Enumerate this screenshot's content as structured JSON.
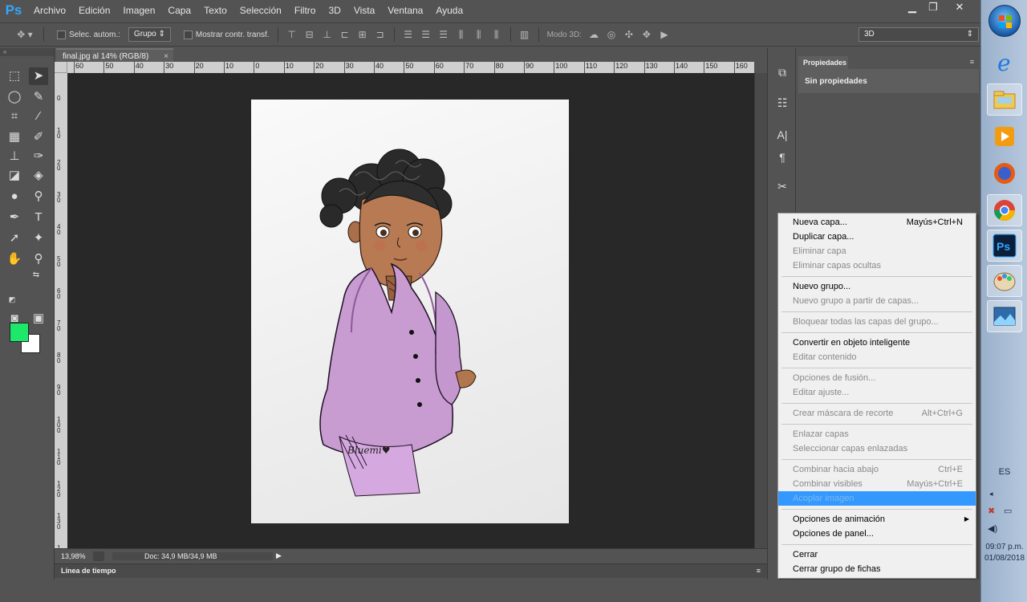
{
  "app": {
    "logo": "Ps",
    "menus": [
      "Archivo",
      "Edición",
      "Imagen",
      "Capa",
      "Texto",
      "Selección",
      "Filtro",
      "3D",
      "Vista",
      "Ventana",
      "Ayuda"
    ]
  },
  "options_bar": {
    "auto_select_label": "Selec. autom.:",
    "auto_select_value": "Grupo",
    "show_transform_label": "Mostrar contr. transf.",
    "mode_3d_label": "Modo 3D:",
    "workspace_value": "3D"
  },
  "document": {
    "tab_title": "final.jpg al 14% (RGB/8)",
    "tab_close": "×",
    "artwork_signature": "Bluemi♥"
  },
  "rulers": {
    "horizontal": [
      "60",
      "50",
      "40",
      "30",
      "20",
      "10",
      "0",
      "10",
      "20",
      "30",
      "40",
      "50",
      "60",
      "70",
      "80",
      "90",
      "100",
      "110",
      "120",
      "130",
      "140",
      "150",
      "160"
    ],
    "vertical": [
      "0",
      "1 0",
      "2 0",
      "3 0",
      "4 0",
      "5 0",
      "6 0",
      "7 0",
      "8 0",
      "9 0",
      "1 0 0",
      "1 1 0",
      "1 2 0",
      "1 3 0",
      "1 4 0"
    ]
  },
  "status": {
    "zoom": "13,98%",
    "doc_size": "Doc: 34,9 MB/34,9 MB"
  },
  "timeline": {
    "label": "Línea de tiempo"
  },
  "properties": {
    "tab_label": "Propiedades",
    "body_text": "Sin propiedades"
  },
  "context_menu": {
    "items": [
      {
        "label": "Nueva capa...",
        "shortcut": "Mayús+Ctrl+N",
        "disabled": false
      },
      {
        "label": "Duplicar capa...",
        "shortcut": "",
        "disabled": false
      },
      {
        "label": "Eliminar capa",
        "shortcut": "",
        "disabled": true
      },
      {
        "label": "Eliminar capas ocultas",
        "shortcut": "",
        "disabled": true
      },
      {
        "sep": true
      },
      {
        "label": "Nuevo grupo...",
        "shortcut": "",
        "disabled": false
      },
      {
        "label": "Nuevo grupo a partir de capas...",
        "shortcut": "",
        "disabled": true
      },
      {
        "sep": true
      },
      {
        "label": "Bloquear todas las capas del grupo...",
        "shortcut": "",
        "disabled": true
      },
      {
        "sep": true
      },
      {
        "label": "Convertir en objeto inteligente",
        "shortcut": "",
        "disabled": false
      },
      {
        "label": "Editar contenido",
        "shortcut": "",
        "disabled": true
      },
      {
        "sep": true
      },
      {
        "label": "Opciones de fusión...",
        "shortcut": "",
        "disabled": true
      },
      {
        "label": "Editar ajuste...",
        "shortcut": "",
        "disabled": true
      },
      {
        "sep": true
      },
      {
        "label": "Crear máscara de recorte",
        "shortcut": "Alt+Ctrl+G",
        "disabled": true
      },
      {
        "sep": true
      },
      {
        "label": "Enlazar capas",
        "shortcut": "",
        "disabled": true
      },
      {
        "label": "Seleccionar capas enlazadas",
        "shortcut": "",
        "disabled": true
      },
      {
        "sep": true
      },
      {
        "label": "Combinar hacia abajo",
        "shortcut": "Ctrl+E",
        "disabled": true
      },
      {
        "label": "Combinar visibles",
        "shortcut": "Mayús+Ctrl+E",
        "disabled": true
      },
      {
        "label": "Acoplar imagen",
        "shortcut": "",
        "disabled": true,
        "highlight": true
      },
      {
        "sep": true
      },
      {
        "label": "Opciones de animación",
        "shortcut": "",
        "disabled": false,
        "submenu": true
      },
      {
        "label": "Opciones de panel...",
        "shortcut": "",
        "disabled": false
      },
      {
        "sep": true
      },
      {
        "label": "Cerrar",
        "shortcut": "",
        "disabled": false
      },
      {
        "label": "Cerrar grupo de fichas",
        "shortcut": "",
        "disabled": false
      }
    ]
  },
  "colors": {
    "foreground": "#1ee86a",
    "background": "#ffffff",
    "menu_highlight": "#3399ff"
  },
  "taskbar": {
    "language": "ES",
    "time": "09:07 p.m.",
    "date": "01/08/2018",
    "apps": [
      "internet-explorer-icon",
      "file-explorer-icon",
      "media-player-icon",
      "firefox-icon",
      "chrome-icon",
      "photoshop-icon",
      "paint-icon",
      "photo-viewer-icon"
    ]
  }
}
